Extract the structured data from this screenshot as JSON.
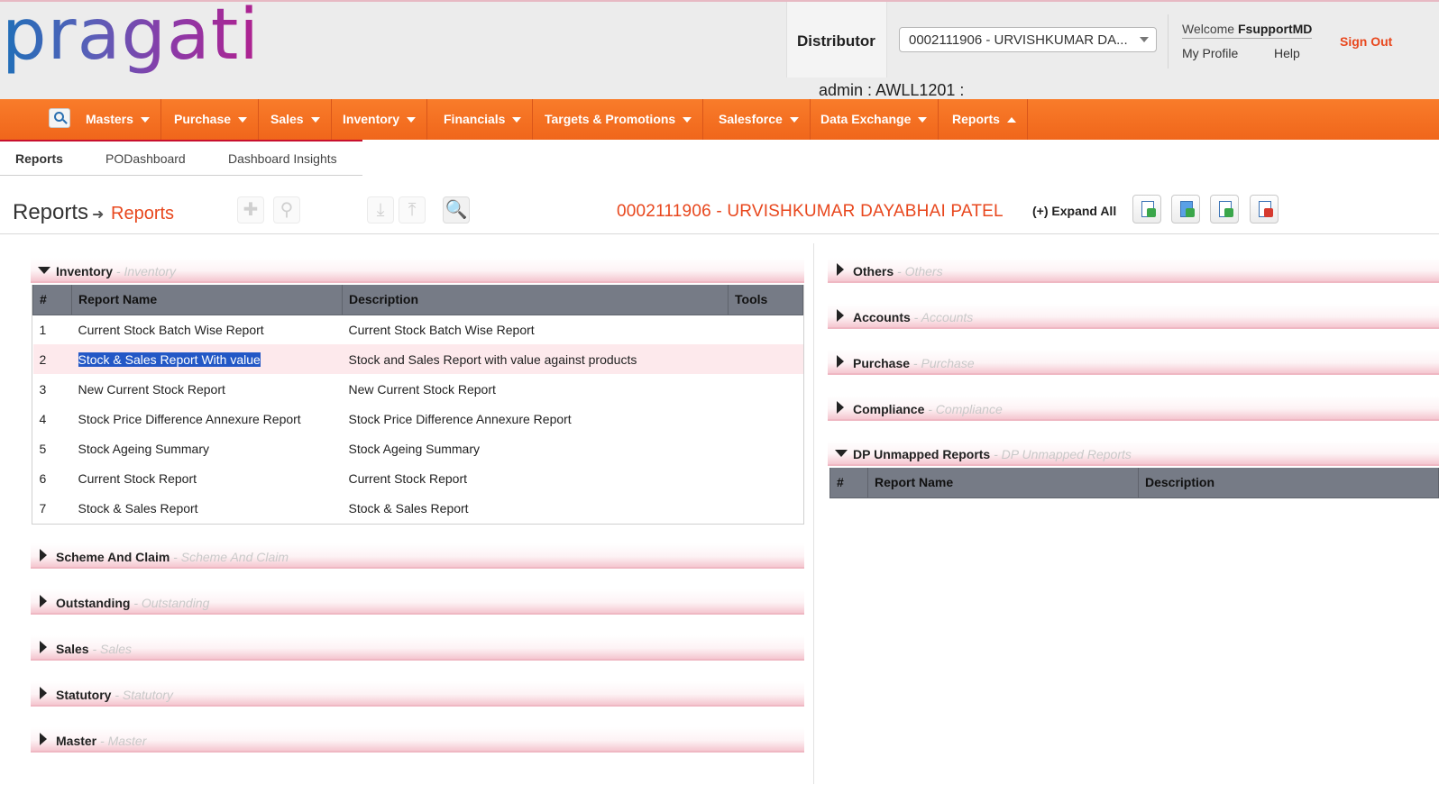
{
  "header": {
    "logo": "pragati",
    "distributor_label": "Distributor",
    "distributor_select": "0002111906 - URVISHKUMAR DA...",
    "welcome_prefix": "Welcome ",
    "welcome_user": "FsupportMD",
    "my_profile": "My Profile",
    "help": "Help",
    "sign_out": "Sign Out",
    "admin_line": "admin : AWLL1201 :"
  },
  "nav": {
    "items": [
      "Masters",
      "Purchase",
      "Sales",
      "Inventory",
      "Financials",
      "Targets & Promotions",
      "Salesforce",
      "Data Exchange",
      "Reports"
    ]
  },
  "subnav": {
    "tabs": [
      "Reports",
      "PODashboard",
      "Dashboard Insights"
    ]
  },
  "titlebar": {
    "title": "Reports",
    "breadcrumb": "Reports",
    "distributor": "0002111906 - URVISHKUMAR DAYABHAI PATEL",
    "expand_all": "(+) Expand All"
  },
  "left_sections": {
    "inventory": {
      "title": "Inventory",
      "subtitle": " - Inventory",
      "columns": [
        "#",
        "Report Name",
        "Description",
        "Tools"
      ],
      "rows": [
        {
          "n": "1",
          "name": "Current Stock Batch Wise Report",
          "desc": "Current Stock Batch Wise Report"
        },
        {
          "n": "2",
          "name": "Stock & Sales Report With value",
          "desc": "Stock and Sales Report with value against products"
        },
        {
          "n": "3",
          "name": "New Current Stock Report",
          "desc": "New Current Stock Report"
        },
        {
          "n": "4",
          "name": "Stock Price Difference Annexure Report",
          "desc": "Stock Price Difference Annexure Report"
        },
        {
          "n": "5",
          "name": "Stock Ageing Summary",
          "desc": "Stock Ageing Summary"
        },
        {
          "n": "6",
          "name": "Current Stock Report",
          "desc": "Current Stock Report"
        },
        {
          "n": "7",
          "name": "Stock & Sales Report",
          "desc": "Stock & Sales Report"
        }
      ]
    },
    "scheme": {
      "title": "Scheme And Claim",
      "subtitle": " - Scheme And Claim"
    },
    "outstanding": {
      "title": "Outstanding",
      "subtitle": " - Outstanding"
    },
    "sales": {
      "title": "Sales",
      "subtitle": " - Sales"
    },
    "statutory": {
      "title": "Statutory",
      "subtitle": " - Statutory"
    },
    "master": {
      "title": "Master",
      "subtitle": " - Master"
    }
  },
  "right_sections": {
    "others": {
      "title": "Others",
      "subtitle": " - Others"
    },
    "accounts": {
      "title": "Accounts",
      "subtitle": " - Accounts"
    },
    "purchase": {
      "title": "Purchase",
      "subtitle": " - Purchase"
    },
    "compliance": {
      "title": "Compliance",
      "subtitle": " - Compliance"
    },
    "dp": {
      "title": "DP Unmapped Reports",
      "subtitle": " - DP Unmapped Reports",
      "columns": [
        "#",
        "Report Name",
        "Description"
      ]
    }
  },
  "colors": {
    "accent_orange": "#f0661b",
    "link_orange": "#e8471d",
    "table_header": "#767b86",
    "section_pink": "#f5c7d0"
  }
}
